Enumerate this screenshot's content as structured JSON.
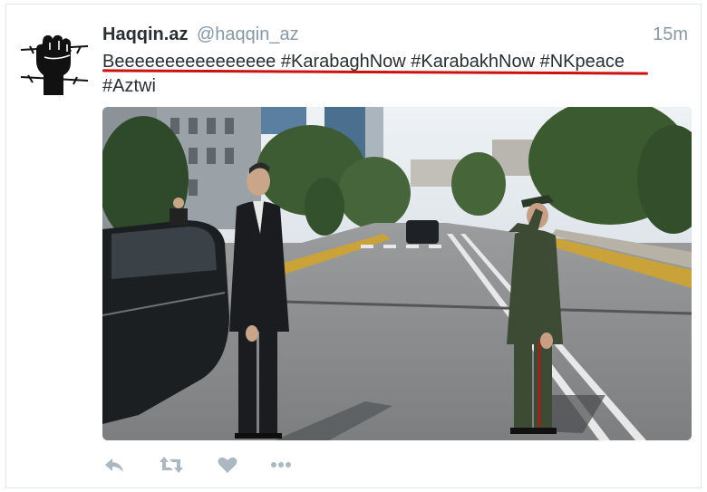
{
  "tweet": {
    "author_name": "Haqqin.az",
    "author_handle": "@haqqin_az",
    "timestamp": "15m",
    "text_line1": "Beeeeeeeeeeeeeeee #KarabaghNow #KarabakhNow #NKpeace",
    "text_line2": "#Aztwi"
  },
  "actions": {
    "icons": [
      "reply-icon",
      "retweet-icon",
      "like-icon",
      "more-icon"
    ]
  },
  "colors": {
    "underline": "#cc1111",
    "muted": "#8899a6",
    "text": "#292f33"
  }
}
